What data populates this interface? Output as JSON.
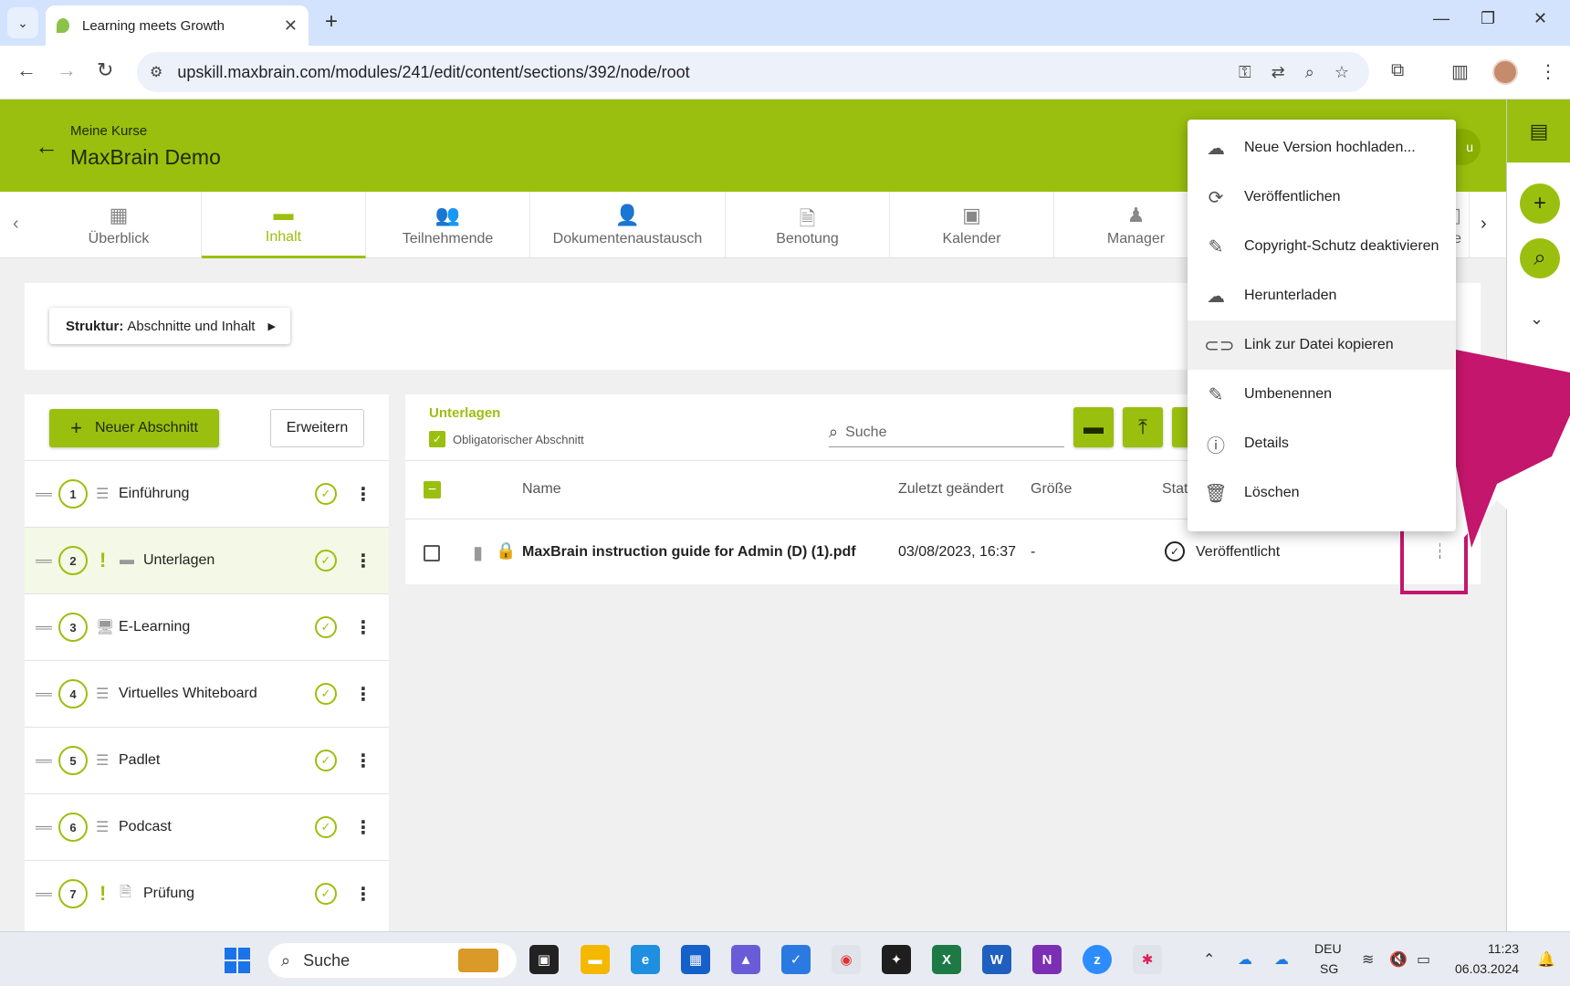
{
  "browser": {
    "tab_title": "Learning meets Growth",
    "url": "upskill.maxbrain.com/modules/241/edit/content/sections/392/node/root"
  },
  "header": {
    "breadcrumb": "Meine Kurse",
    "title": "MaxBrain Demo",
    "pill_text": "u"
  },
  "nav_tabs": [
    {
      "label": "Überblick",
      "icon": "dashboard-icon",
      "active": false
    },
    {
      "label": "Inhalt",
      "icon": "folder-icon",
      "active": true
    },
    {
      "label": "Teilnehmende",
      "icon": "people-icon",
      "active": false
    },
    {
      "label": "Dokumentenaustausch",
      "icon": "shared-user-icon",
      "active": false
    },
    {
      "label": "Benotung",
      "icon": "grade-icon",
      "active": false
    },
    {
      "label": "Kalender",
      "icon": "calendar-icon",
      "active": false
    },
    {
      "label": "Manager",
      "icon": "manager-icon",
      "active": false
    },
    {
      "label": "te",
      "icon": "page-icon",
      "active": false
    }
  ],
  "structure": {
    "prefix": "Struktur:",
    "value": "Abschnitte und Inhalt"
  },
  "left_panel": {
    "new_section_label": "Neuer Abschnitt",
    "expand_label": "Erweitern",
    "sections": [
      {
        "number": "1",
        "label": "Einführung",
        "icon": "text-lines-icon",
        "mandatory": false,
        "active": false
      },
      {
        "number": "2",
        "label": "Unterlagen",
        "icon": "folder-icon",
        "mandatory": true,
        "active": true
      },
      {
        "number": "3",
        "label": "E-Learning",
        "icon": "elearning-icon",
        "mandatory": false,
        "active": false
      },
      {
        "number": "4",
        "label": "Virtuelles Whiteboard",
        "icon": "text-lines-icon",
        "mandatory": false,
        "active": false
      },
      {
        "number": "5",
        "label": "Padlet",
        "icon": "text-lines-icon",
        "mandatory": false,
        "active": false
      },
      {
        "number": "6",
        "label": "Podcast",
        "icon": "text-lines-icon",
        "mandatory": false,
        "active": false
      },
      {
        "number": "7",
        "label": "Prüfung",
        "icon": "exam-icon",
        "mandatory": true,
        "active": false
      }
    ]
  },
  "main": {
    "section_title": "Unterlagen",
    "mandatory_label": "Obligatorischer Abschnitt",
    "search_placeholder": "Suche",
    "columns": {
      "name": "Name",
      "modified": "Zuletzt geändert",
      "size": "Größe",
      "status": "Stat"
    },
    "rows": [
      {
        "name": "MaxBrain instruction guide for Admin (D) (1).pdf",
        "modified": "03/08/2023, 16:37",
        "size": "-",
        "status": "Veröffentlicht"
      }
    ]
  },
  "context_menu": {
    "items": [
      {
        "label": "Neue Version hochladen...",
        "icon": "cloud-upload-icon"
      },
      {
        "label": "Veröffentlichen",
        "icon": "sync-icon"
      },
      {
        "label": "Copyright-Schutz deaktivieren",
        "icon": "pencil-icon"
      },
      {
        "label": "Herunterladen",
        "icon": "cloud-download-icon"
      },
      {
        "label": "Link zur Datei kopieren",
        "icon": "link-icon"
      },
      {
        "label": "Umbenennen",
        "icon": "pencil-icon"
      },
      {
        "label": "Details",
        "icon": "info-icon"
      },
      {
        "label": "Löschen",
        "icon": "trash-icon"
      }
    ]
  },
  "taskbar": {
    "search_label": "Suche",
    "lang_top": "DEU",
    "lang_bottom": "SG",
    "time": "11:23",
    "date": "06.03.2024"
  },
  "colors": {
    "brand": "#9bbf0e",
    "annotation": "#c4166c"
  }
}
